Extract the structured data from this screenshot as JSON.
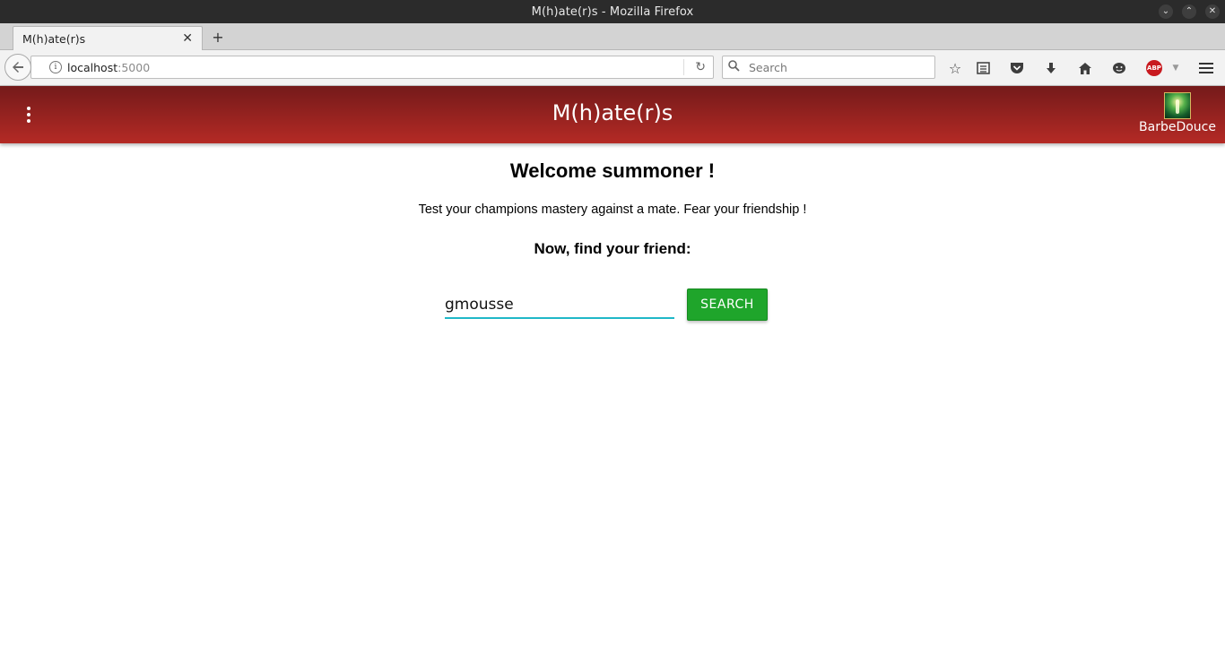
{
  "window": {
    "title": "M(h)ate(r)s - Mozilla Firefox",
    "controls": [
      "minimize-icon",
      "maximize-icon",
      "close-icon"
    ]
  },
  "browser": {
    "tab": {
      "title": "M(h)ate(r)s",
      "close_glyph": "✕"
    },
    "new_tab_glyph": "+",
    "url": {
      "host": "localhost",
      "port": ":5000"
    },
    "search": {
      "placeholder": "Search"
    },
    "toolbar_icons": [
      "bookmark-star-icon",
      "reader-list-icon",
      "pocket-icon",
      "download-icon",
      "home-icon",
      "chat-icon",
      "adblock-plus-icon",
      "dropdown-arrow-icon",
      "menu-icon"
    ],
    "abp_label": "ABP"
  },
  "app": {
    "title": "M(h)ate(r)s",
    "username": "BarbeDouce",
    "heading": "Welcome summoner !",
    "tagline": "Test your champions mastery against a mate. Fear your friendship !",
    "prompt": "Now, find your friend:",
    "friend_input_value": "gmousse",
    "search_button_label": "SEARCH",
    "colors": {
      "header_top": "#741a1a",
      "header_bottom": "#b42a25",
      "button": "#1fa52b",
      "input_underline": "#1fb8c8"
    }
  }
}
